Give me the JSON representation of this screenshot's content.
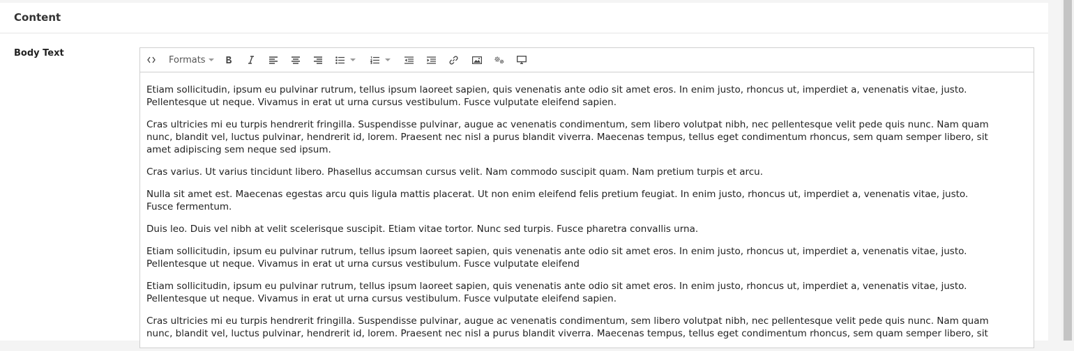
{
  "section": {
    "title": "Content"
  },
  "field": {
    "label": "Body Text"
  },
  "toolbar": {
    "formats_label": "Formats",
    "buttons": [
      "source-code",
      "formats",
      "bold",
      "italic",
      "align-left",
      "align-center",
      "align-right",
      "bullet-list",
      "numbered-list",
      "outdent",
      "indent",
      "link",
      "image",
      "special-settings",
      "preview"
    ]
  },
  "editor": {
    "paragraphs": [
      "Etiam sollicitudin, ipsum eu pulvinar rutrum, tellus ipsum laoreet sapien, quis venenatis ante odio sit amet eros. In enim justo, rhoncus ut, imperdiet a, venenatis vitae, justo.\nPellentesque ut neque. Vivamus in erat ut urna cursus vestibulum. Fusce vulputate eleifend sapien.",
      "Cras ultricies mi eu turpis hendrerit fringilla. Suspendisse pulvinar, augue ac venenatis condimentum, sem libero volutpat nibh, nec pellentesque velit pede quis nunc. Nam quam\nnunc, blandit vel, luctus pulvinar, hendrerit id, lorem. Praesent nec nisl a purus blandit viverra. Maecenas tempus, tellus eget condimentum rhoncus, sem quam semper libero, sit\namet adipiscing sem neque sed ipsum.",
      "Cras varius. Ut varius tincidunt libero. Phasellus accumsan cursus velit. Nam commodo suscipit quam. Nam pretium turpis et arcu.",
      "Nulla sit amet est. Maecenas egestas arcu quis ligula mattis placerat. Ut non enim eleifend felis pretium feugiat. In enim justo, rhoncus ut, imperdiet a, venenatis vitae, justo.\nFusce fermentum.",
      "Duis leo. Duis vel nibh at velit scelerisque suscipit. Etiam vitae tortor. Nunc sed turpis. Fusce pharetra convallis urna.",
      "Etiam sollicitudin, ipsum eu pulvinar rutrum, tellus ipsum laoreet sapien, quis venenatis ante odio sit amet eros. In enim justo, rhoncus ut, imperdiet a, venenatis vitae, justo.\nPellentesque ut neque. Vivamus in erat ut urna cursus vestibulum. Fusce vulputate eleifend",
      "Etiam sollicitudin, ipsum eu pulvinar rutrum, tellus ipsum laoreet sapien, quis venenatis ante odio sit amet eros. In enim justo, rhoncus ut, imperdiet a, venenatis vitae, justo.\nPellentesque ut neque. Vivamus in erat ut urna cursus vestibulum. Fusce vulputate eleifend sapien.",
      "Cras ultricies mi eu turpis hendrerit fringilla. Suspendisse pulvinar, augue ac venenatis condimentum, sem libero volutpat nibh, nec pellentesque velit pede quis nunc. Nam quam\nnunc, blandit vel, luctus pulvinar, hendrerit id, lorem. Praesent nec nisl a purus blandit viverra. Maecenas tempus, tellus eget condimentum rhoncus, sem quam semper libero, sit"
    ]
  },
  "colors": {
    "spellcheck_underline": "#d9302a",
    "border": "#cfcfcf",
    "icon": "#444444"
  }
}
